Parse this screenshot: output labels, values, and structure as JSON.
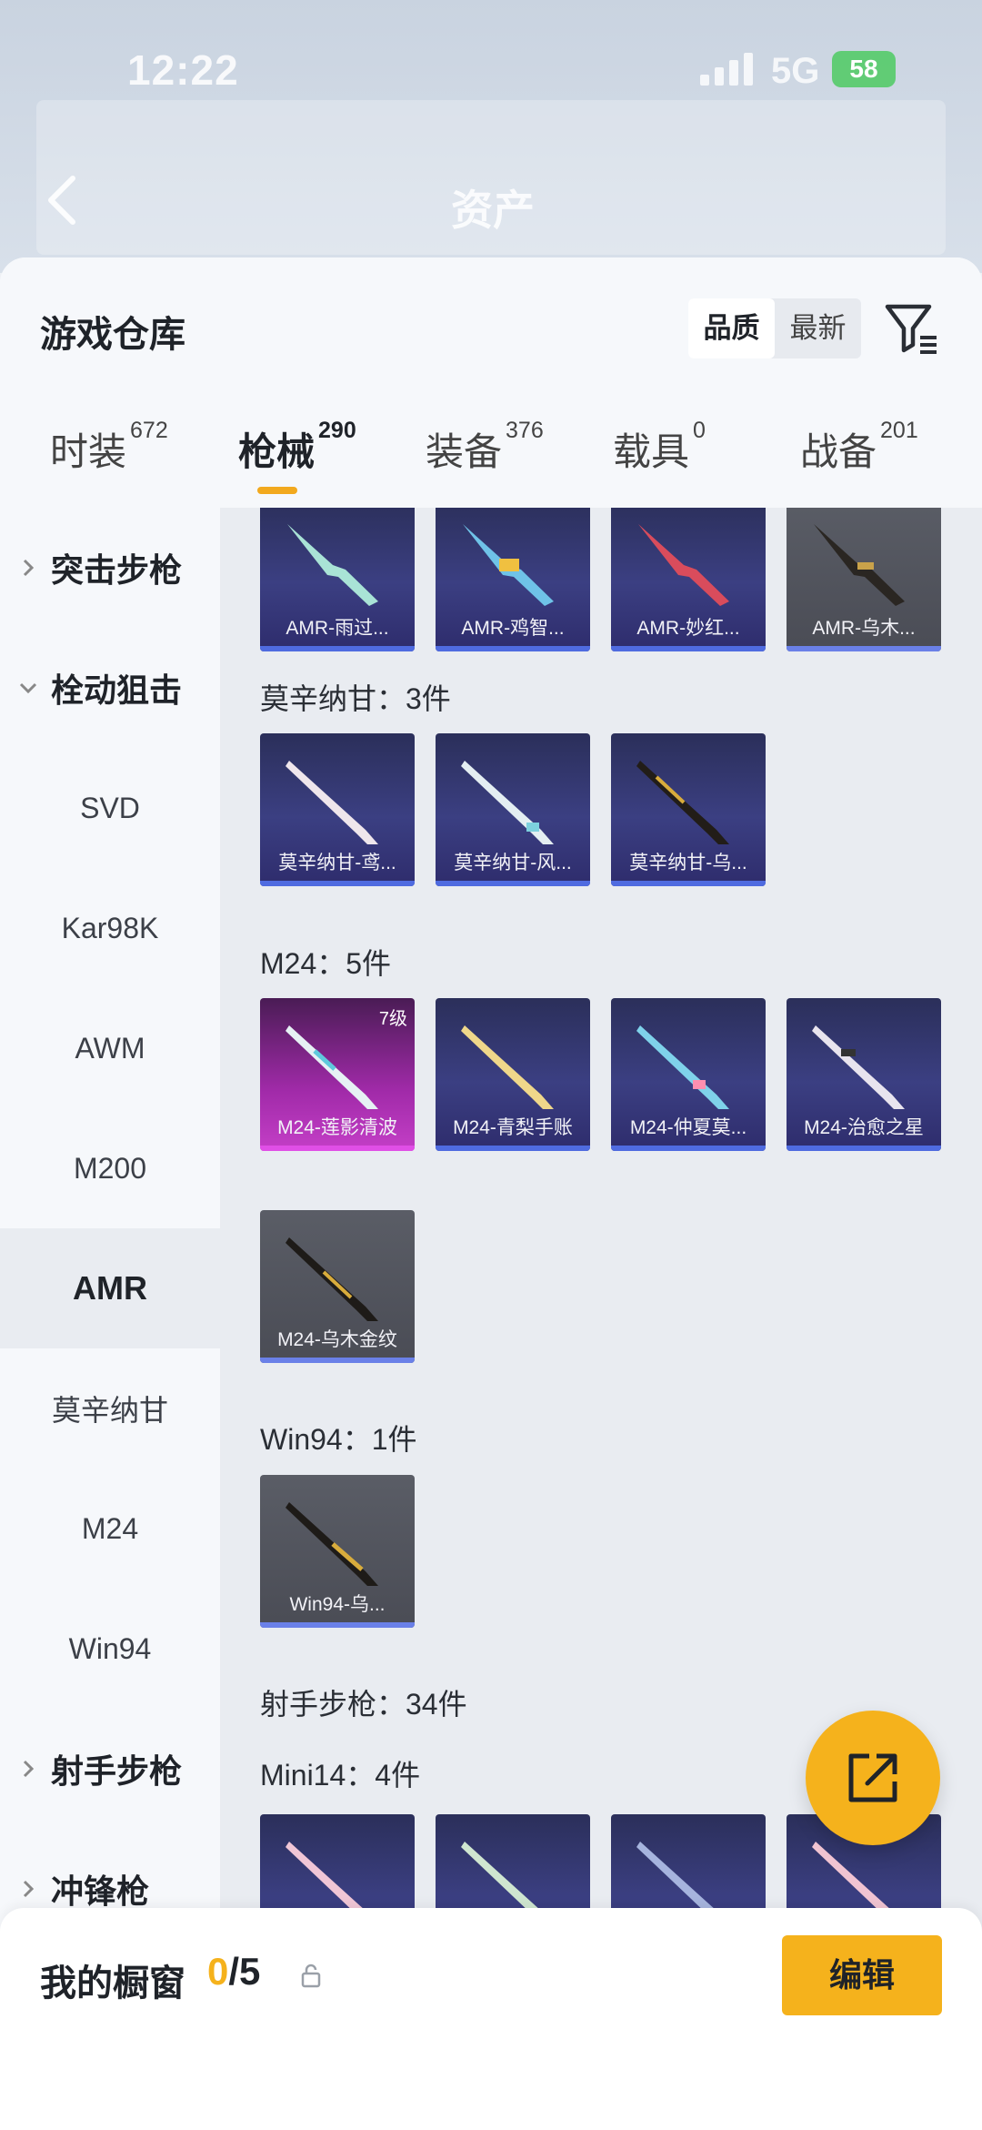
{
  "status_bar": {
    "time": "12:22",
    "network": "5G",
    "battery": "58"
  },
  "header": {
    "title": "资产"
  },
  "sheet": {
    "title": "游戏仓库",
    "sort_options": [
      "品质",
      "最新"
    ],
    "active_sort": "品质"
  },
  "tabs": [
    {
      "label": "时装",
      "count": "672"
    },
    {
      "label": "枪械",
      "count": "290"
    },
    {
      "label": "装备",
      "count": "376"
    },
    {
      "label": "载具",
      "count": "0"
    },
    {
      "label": "战备",
      "count": "201"
    }
  ],
  "active_tab": "枪械",
  "sidebar": [
    {
      "label": "突击步枪",
      "type": "group",
      "expanded": false
    },
    {
      "label": "栓动狙击",
      "type": "group",
      "expanded": true
    },
    {
      "label": "SVD",
      "type": "sub"
    },
    {
      "label": "Kar98K",
      "type": "sub"
    },
    {
      "label": "AWM",
      "type": "sub"
    },
    {
      "label": "M200",
      "type": "sub"
    },
    {
      "label": "AMR",
      "type": "sub",
      "selected": true
    },
    {
      "label": "莫辛纳甘",
      "type": "sub"
    },
    {
      "label": "M24",
      "type": "sub"
    },
    {
      "label": "Win94",
      "type": "sub"
    },
    {
      "label": "射手步枪",
      "type": "group",
      "expanded": false
    },
    {
      "label": "冲锋枪",
      "type": "group",
      "expanded": false
    }
  ],
  "sections": {
    "amr_cards": [
      "AMR-雨过...",
      "AMR-鸡智...",
      "AMR-妙红...",
      "AMR-乌木..."
    ],
    "mosin_label": "莫辛纳甘：3件",
    "mosin_cards": [
      "莫辛纳甘-鸢...",
      "莫辛纳甘-风...",
      "莫辛纳甘-乌..."
    ],
    "m24_label": "M24：5件",
    "m24_cards": [
      "M24-莲影清波",
      "M24-青梨手账",
      "M24-仲夏莫...",
      "M24-治愈之星",
      "M24-乌木金纹"
    ],
    "m24_level": "7级",
    "win94_label": "Win94：1件",
    "win94_cards": [
      "Win94-乌..."
    ],
    "dmr_label": "射手步枪：34件",
    "mini14_label": "Mini14：4件"
  },
  "bottom": {
    "label": "我的橱窗",
    "current": "0",
    "total": "/5",
    "edit_label": "编辑"
  },
  "colors": {
    "accent": "#f5b21c",
    "card_purple": "#3b3f82",
    "card_grey": "#4a4c55",
    "card_pink": "#c43fc7"
  }
}
